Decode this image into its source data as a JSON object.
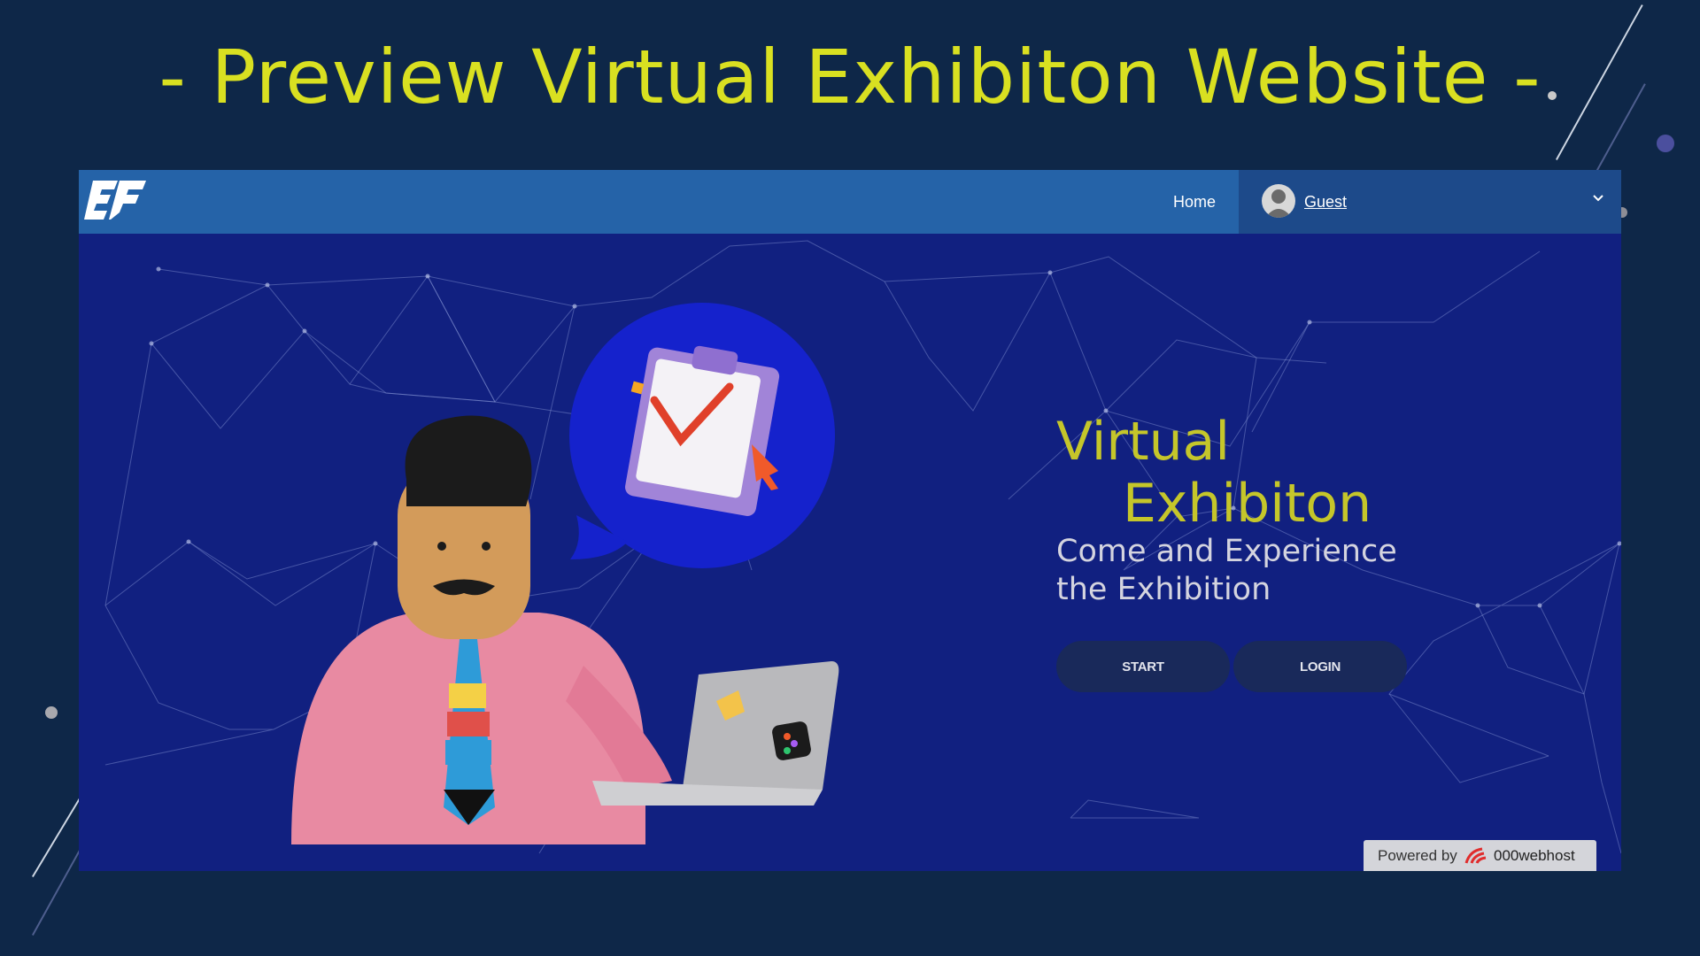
{
  "slide": {
    "title": "- Preview Virtual Exhibiton Website -"
  },
  "navbar": {
    "logo": "EE-logo",
    "home_label": "Home",
    "user_label": "Guest",
    "avatar_icon": "user-avatar-icon",
    "dropdown_icon": "chevron-down-icon"
  },
  "hero": {
    "title_line1": "Virtual",
    "title_line2": "Exhibiton",
    "subtitle": "Come and Experience the Exhibition",
    "start_label": "START",
    "login_label": "LOGIN"
  },
  "footer_badge": {
    "prefix": "Powered by",
    "brand": "000webhost"
  },
  "colors": {
    "slide_bg": "#0e2748",
    "title": "#d9e021",
    "navbar": "#2563a8",
    "hero_bg": "#112080",
    "hero_title": "#c5c62a",
    "button_bg": "#19295a"
  }
}
